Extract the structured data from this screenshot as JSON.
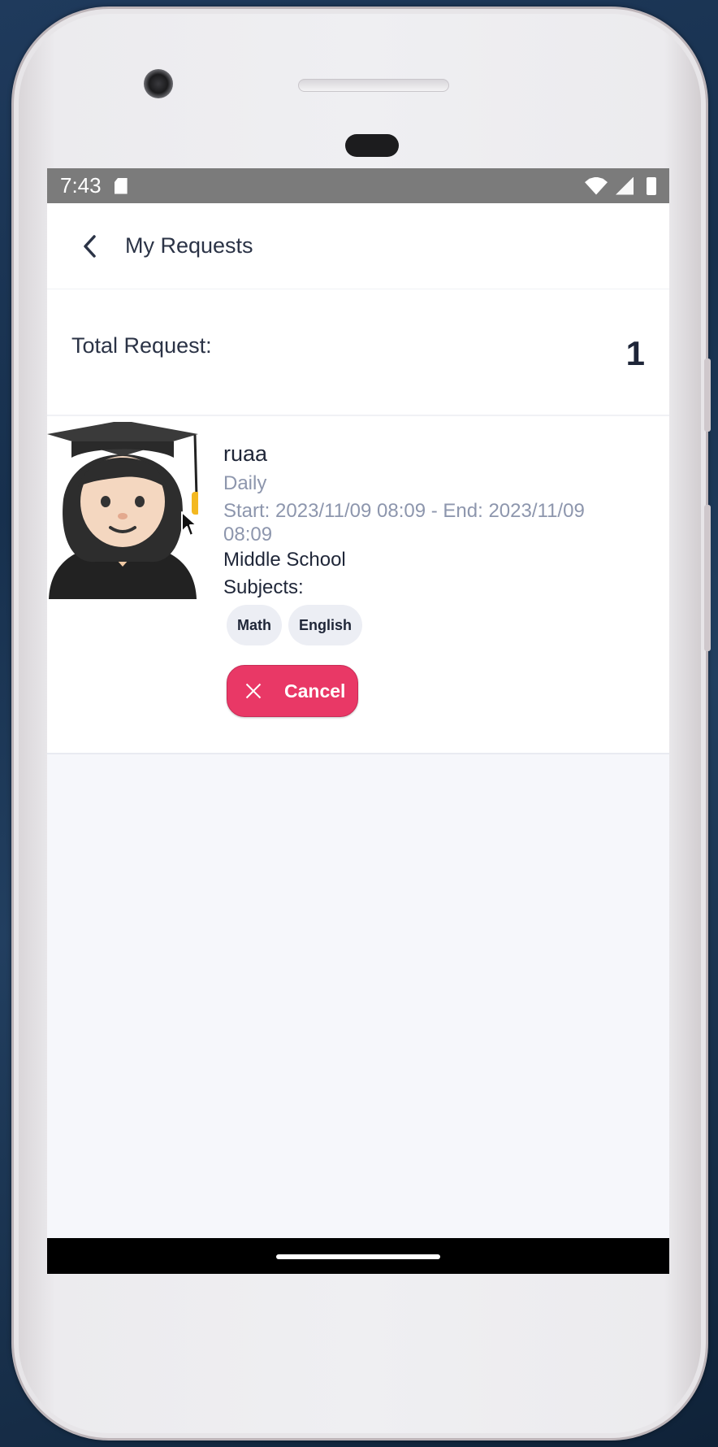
{
  "status_bar": {
    "time": "7:43"
  },
  "appbar": {
    "title": "My Requests"
  },
  "summary": {
    "label": "Total Request:",
    "count": "1"
  },
  "requests": [
    {
      "name": "ruaa",
      "frequency": "Daily",
      "dates": "Start: 2023/11/09 08:09 - End: 2023/11/09 08:09",
      "level": "Middle School",
      "subjects_label": "Subjects:",
      "subjects": [
        "Math",
        "English"
      ],
      "cancel_label": "Cancel"
    }
  ],
  "colors": {
    "accent": "#e93866",
    "status_bar": "#7b7b7b",
    "secondary_text": "#8d96ad",
    "screen_bg": "#f6f7fb"
  },
  "icons": {
    "back": "chevron-left-icon",
    "cancel": "close-icon",
    "avatar": "student-graduate-icon"
  }
}
